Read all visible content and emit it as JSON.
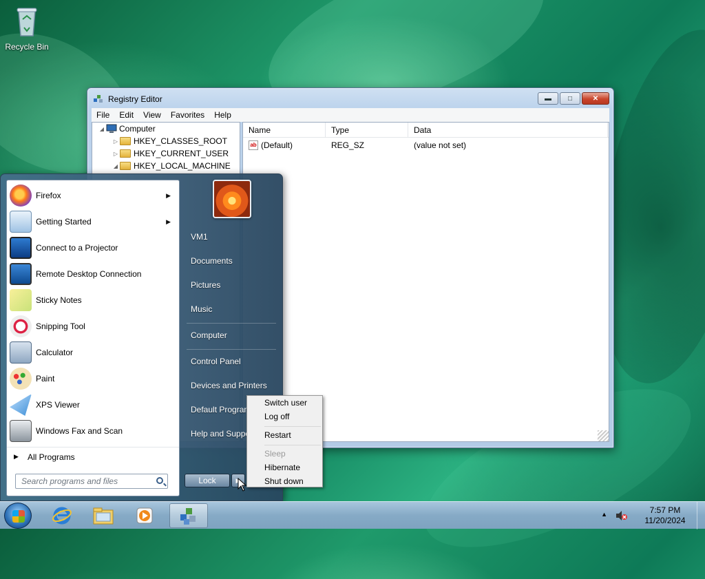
{
  "desktop": {
    "recycle_bin_label": "Recycle Bin"
  },
  "regedit": {
    "title": "Registry Editor",
    "menu": [
      "File",
      "Edit",
      "View",
      "Favorites",
      "Help"
    ],
    "tree": {
      "root": "Computer",
      "keys": [
        "HKEY_CLASSES_ROOT",
        "HKEY_CURRENT_USER",
        "HKEY_LOCAL_MACHINE"
      ]
    },
    "columns": [
      "Name",
      "Type",
      "Data"
    ],
    "rows": [
      {
        "name": "(Default)",
        "type": "REG_SZ",
        "data": "(value not set)"
      }
    ]
  },
  "start_menu": {
    "programs": [
      {
        "label": "Firefox",
        "icon": "firefox-icon",
        "submenu": true
      },
      {
        "label": "Getting Started",
        "icon": "getting-started-icon",
        "submenu": true
      },
      {
        "label": "Connect to a Projector",
        "icon": "projector-icon",
        "submenu": false
      },
      {
        "label": "Remote Desktop Connection",
        "icon": "remote-desktop-icon",
        "submenu": false
      },
      {
        "label": "Sticky Notes",
        "icon": "sticky-notes-icon",
        "submenu": false
      },
      {
        "label": "Snipping Tool",
        "icon": "snipping-tool-icon",
        "submenu": false
      },
      {
        "label": "Calculator",
        "icon": "calculator-icon",
        "submenu": false
      },
      {
        "label": "Paint",
        "icon": "paint-icon",
        "submenu": false
      },
      {
        "label": "XPS Viewer",
        "icon": "xps-viewer-icon",
        "submenu": false
      },
      {
        "label": "Windows Fax and Scan",
        "icon": "fax-scan-icon",
        "submenu": false
      }
    ],
    "all_programs": "All Programs",
    "search_placeholder": "Search programs and files",
    "right_links": [
      "VM1",
      "Documents",
      "Pictures",
      "Music",
      "Computer",
      "Control Panel",
      "Devices and Printers",
      "Default Programs",
      "Help and Support"
    ],
    "lock_label": "Lock",
    "power_menu": {
      "items": [
        "Switch user",
        "Log off",
        "Restart",
        "Sleep",
        "Hibernate",
        "Shut down"
      ],
      "disabled": [
        "Sleep"
      ]
    }
  },
  "taskbar": {
    "pinned": [
      "internet-explorer-icon",
      "file-explorer-icon",
      "media-player-icon",
      "regedit-icon"
    ],
    "time": "7:57 PM",
    "date": "11/20/2024"
  },
  "colors": {
    "accent": "#1f9a6b",
    "start_menu_bg": "#3d6283"
  }
}
